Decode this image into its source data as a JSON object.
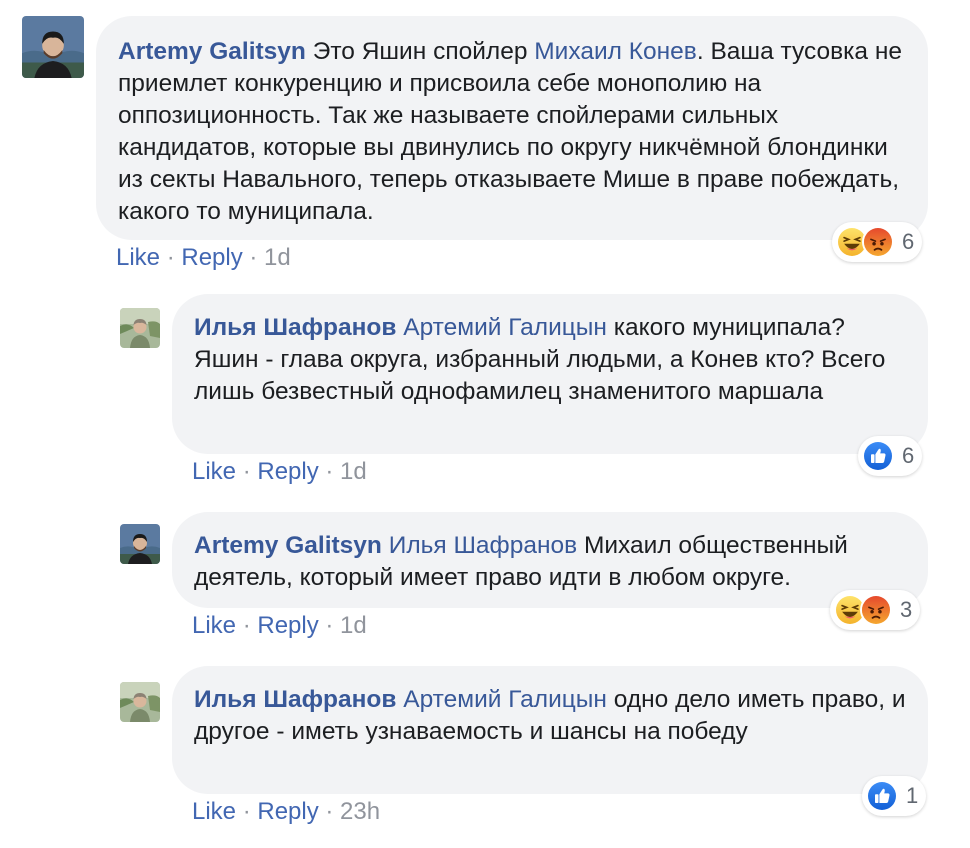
{
  "comments": [
    {
      "author": "Artemy Galitsyn",
      "mention": "",
      "text_pre": "Это Яшин спойлер ",
      "inline_mention": "Михаил Конев",
      "text_post": ". Ваша тусовка не приемлет конкуренцию и присвоила себе монополию на оппозиционность. Так же называете спойлерами сильных кандидатов, которые вы двинулись по округу никчёмной блондинки из секты Навального, теперь отказываете Мише в праве побеждать, какого то муниципала.",
      "like_label": "Like",
      "reply_label": "Reply",
      "time": "1d",
      "reaction_icons": [
        "haha-icon",
        "angry-icon"
      ],
      "reaction_count": "6"
    },
    {
      "author": "Илья Шафранов",
      "mention": "Артемий Галицын",
      "text": "какого муниципала? Яшин - глава округа, избранный людьми, а Конев кто? Всего лишь безвестный однофамилец знаменитого маршала",
      "like_label": "Like",
      "reply_label": "Reply",
      "time": "1d",
      "reaction_icons": [
        "like-icon"
      ],
      "reaction_count": "6"
    },
    {
      "author": "Artemy Galitsyn",
      "mention": "Илья Шафранов",
      "text": "Михаил общественный деятель, который имеет право идти в любом округе.",
      "like_label": "Like",
      "reply_label": "Reply",
      "time": "1d",
      "reaction_icons": [
        "haha-icon",
        "angry-icon"
      ],
      "reaction_count": "3"
    },
    {
      "author": "Илья Шафранов",
      "mention": "Артемий Галицын",
      "text": "одно дело иметь право, и другое - иметь узнаваемость и шансы на победу",
      "like_label": "Like",
      "reply_label": "Reply",
      "time": "23h",
      "reaction_icons": [
        "like-icon"
      ],
      "reaction_count": "1"
    }
  ],
  "separator": " · ",
  "colors": {
    "link": "#385898",
    "action_link": "#4267b2",
    "bubble_bg": "#f2f3f5",
    "meta": "#90949c",
    "like_blue": "#1877f2",
    "haha_yellow": "#f7c744",
    "angry_orange": "#e9710f"
  }
}
